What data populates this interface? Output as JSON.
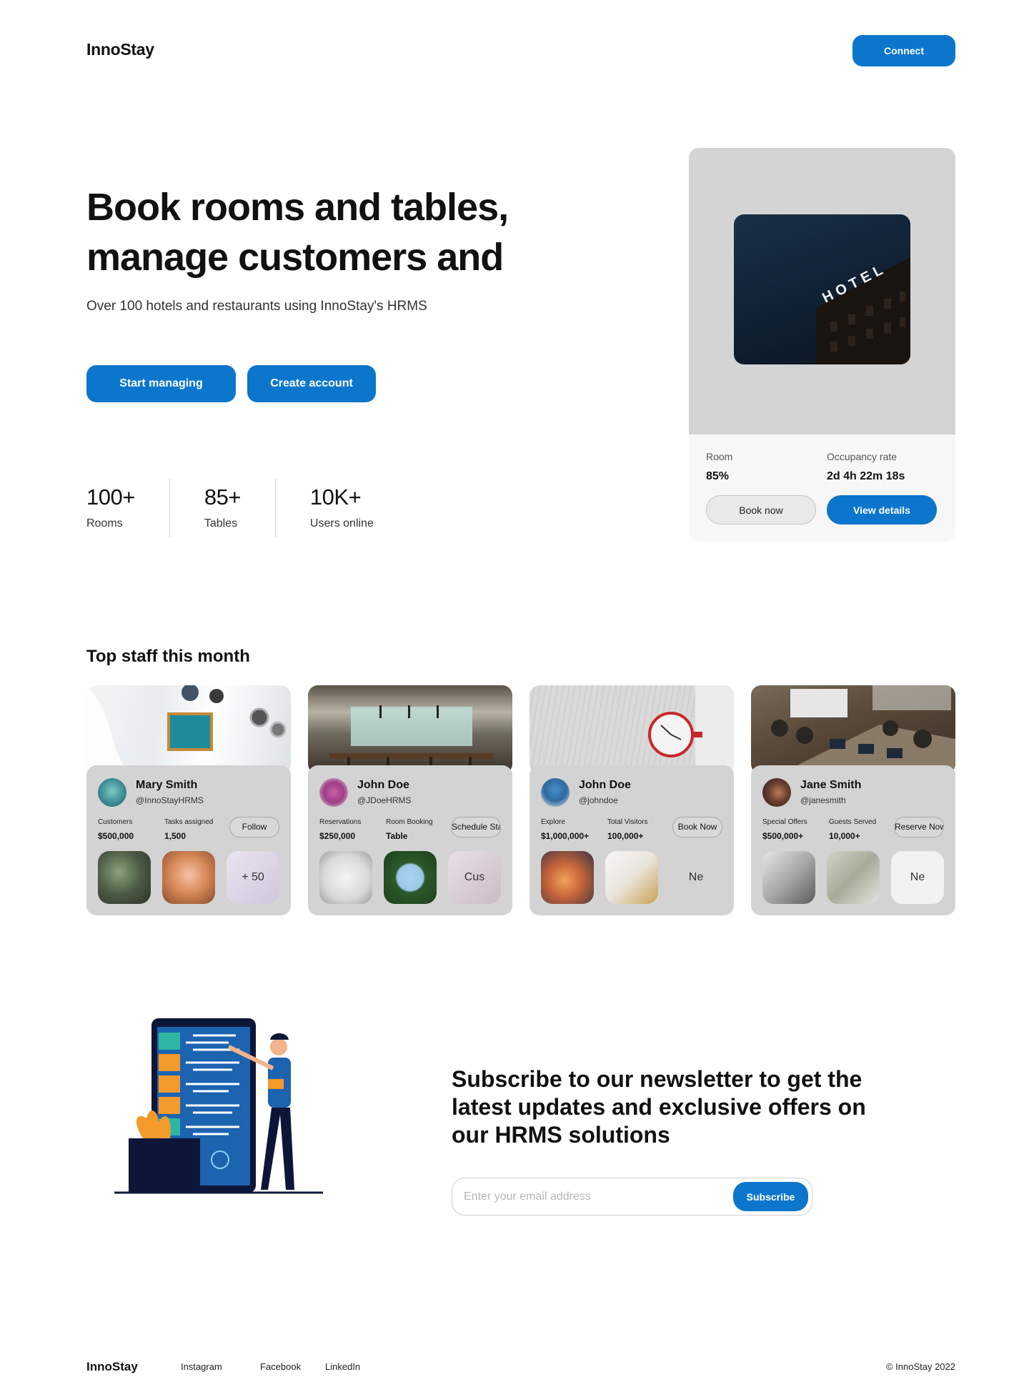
{
  "header": {
    "logo": "InnoStay",
    "connect_label": "Connect"
  },
  "hero": {
    "title": "Book rooms and tables, manage customers and",
    "subtitle": "Over 100 hotels and restaurants using InnoStay's HRMS",
    "primary_label": "Start managing",
    "secondary_label": "Create account",
    "stats": [
      {
        "value": "100+",
        "label": "Rooms"
      },
      {
        "value": "85+",
        "label": "Tables"
      },
      {
        "value": "10K+",
        "label": "Users online"
      }
    ]
  },
  "hotel_card": {
    "sign_text": "HOTEL",
    "room_label": "Room",
    "room_value": "85%",
    "occupancy_label": "Occupancy rate",
    "occupancy_value": "2d 4h 22m 18s",
    "book_label": "Book now",
    "details_label": "View details"
  },
  "staff": {
    "title": "Top staff this month",
    "cards": [
      {
        "name": "Mary Smith",
        "handle": "@InnoStayHRMS",
        "k1_label": "Customers",
        "k1_value": "$500,000",
        "k2_label": "Tasks assigned",
        "k2_value": "1,500",
        "action": "Follow",
        "extra": "+ 50"
      },
      {
        "name": "John Doe",
        "handle": "@JDoeHRMS",
        "k1_label": "Reservations",
        "k1_value": "$250,000",
        "k2_label": "Room Booking",
        "k2_value": "Table",
        "action": "Schedule Stay",
        "extra": "Cus"
      },
      {
        "name": "John Doe",
        "handle": "@johndoe",
        "k1_label": "Explore",
        "k1_value": "$1,000,000+",
        "k2_label": "Total Visitors",
        "k2_value": "100,000+",
        "action": "Book Now",
        "extra": "Ne"
      },
      {
        "name": "Jane Smith",
        "handle": "@janesmith",
        "k1_label": "Special Offers",
        "k1_value": "$500,000+",
        "k2_label": "Guests Served",
        "k2_value": "10,000+",
        "action": "Reserve Now",
        "extra": "Ne"
      }
    ]
  },
  "newsletter": {
    "title": "Subscribe to our newsletter to get the latest updates and exclusive offers on our HRMS solutions",
    "placeholder": "Enter your email address",
    "button_label": "Subscribe"
  },
  "footer": {
    "logo": "InnoStay",
    "links": [
      "Instagram",
      "Facebook",
      "LinkedIn"
    ],
    "copyright": "© InnoStay 2022"
  },
  "colors": {
    "accent": "#0b76cc",
    "card_grey": "#d3d3d3",
    "text": "#111111"
  }
}
